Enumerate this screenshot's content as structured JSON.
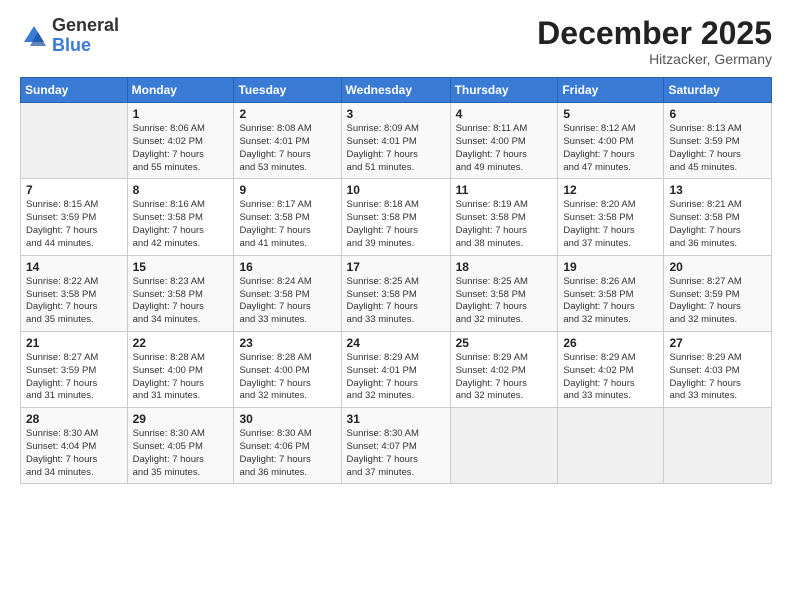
{
  "logo": {
    "general": "General",
    "blue": "Blue"
  },
  "title": "December 2025",
  "subtitle": "Hitzacker, Germany",
  "days_of_week": [
    "Sunday",
    "Monday",
    "Tuesday",
    "Wednesday",
    "Thursday",
    "Friday",
    "Saturday"
  ],
  "weeks": [
    [
      {
        "day": "",
        "info": ""
      },
      {
        "day": "1",
        "info": "Sunrise: 8:06 AM\nSunset: 4:02 PM\nDaylight: 7 hours\nand 55 minutes."
      },
      {
        "day": "2",
        "info": "Sunrise: 8:08 AM\nSunset: 4:01 PM\nDaylight: 7 hours\nand 53 minutes."
      },
      {
        "day": "3",
        "info": "Sunrise: 8:09 AM\nSunset: 4:01 PM\nDaylight: 7 hours\nand 51 minutes."
      },
      {
        "day": "4",
        "info": "Sunrise: 8:11 AM\nSunset: 4:00 PM\nDaylight: 7 hours\nand 49 minutes."
      },
      {
        "day": "5",
        "info": "Sunrise: 8:12 AM\nSunset: 4:00 PM\nDaylight: 7 hours\nand 47 minutes."
      },
      {
        "day": "6",
        "info": "Sunrise: 8:13 AM\nSunset: 3:59 PM\nDaylight: 7 hours\nand 45 minutes."
      }
    ],
    [
      {
        "day": "7",
        "info": "Sunrise: 8:15 AM\nSunset: 3:59 PM\nDaylight: 7 hours\nand 44 minutes."
      },
      {
        "day": "8",
        "info": "Sunrise: 8:16 AM\nSunset: 3:58 PM\nDaylight: 7 hours\nand 42 minutes."
      },
      {
        "day": "9",
        "info": "Sunrise: 8:17 AM\nSunset: 3:58 PM\nDaylight: 7 hours\nand 41 minutes."
      },
      {
        "day": "10",
        "info": "Sunrise: 8:18 AM\nSunset: 3:58 PM\nDaylight: 7 hours\nand 39 minutes."
      },
      {
        "day": "11",
        "info": "Sunrise: 8:19 AM\nSunset: 3:58 PM\nDaylight: 7 hours\nand 38 minutes."
      },
      {
        "day": "12",
        "info": "Sunrise: 8:20 AM\nSunset: 3:58 PM\nDaylight: 7 hours\nand 37 minutes."
      },
      {
        "day": "13",
        "info": "Sunrise: 8:21 AM\nSunset: 3:58 PM\nDaylight: 7 hours\nand 36 minutes."
      }
    ],
    [
      {
        "day": "14",
        "info": "Sunrise: 8:22 AM\nSunset: 3:58 PM\nDaylight: 7 hours\nand 35 minutes."
      },
      {
        "day": "15",
        "info": "Sunrise: 8:23 AM\nSunset: 3:58 PM\nDaylight: 7 hours\nand 34 minutes."
      },
      {
        "day": "16",
        "info": "Sunrise: 8:24 AM\nSunset: 3:58 PM\nDaylight: 7 hours\nand 33 minutes."
      },
      {
        "day": "17",
        "info": "Sunrise: 8:25 AM\nSunset: 3:58 PM\nDaylight: 7 hours\nand 33 minutes."
      },
      {
        "day": "18",
        "info": "Sunrise: 8:25 AM\nSunset: 3:58 PM\nDaylight: 7 hours\nand 32 minutes."
      },
      {
        "day": "19",
        "info": "Sunrise: 8:26 AM\nSunset: 3:58 PM\nDaylight: 7 hours\nand 32 minutes."
      },
      {
        "day": "20",
        "info": "Sunrise: 8:27 AM\nSunset: 3:59 PM\nDaylight: 7 hours\nand 32 minutes."
      }
    ],
    [
      {
        "day": "21",
        "info": "Sunrise: 8:27 AM\nSunset: 3:59 PM\nDaylight: 7 hours\nand 31 minutes."
      },
      {
        "day": "22",
        "info": "Sunrise: 8:28 AM\nSunset: 4:00 PM\nDaylight: 7 hours\nand 31 minutes."
      },
      {
        "day": "23",
        "info": "Sunrise: 8:28 AM\nSunset: 4:00 PM\nDaylight: 7 hours\nand 32 minutes."
      },
      {
        "day": "24",
        "info": "Sunrise: 8:29 AM\nSunset: 4:01 PM\nDaylight: 7 hours\nand 32 minutes."
      },
      {
        "day": "25",
        "info": "Sunrise: 8:29 AM\nSunset: 4:02 PM\nDaylight: 7 hours\nand 32 minutes."
      },
      {
        "day": "26",
        "info": "Sunrise: 8:29 AM\nSunset: 4:02 PM\nDaylight: 7 hours\nand 33 minutes."
      },
      {
        "day": "27",
        "info": "Sunrise: 8:29 AM\nSunset: 4:03 PM\nDaylight: 7 hours\nand 33 minutes."
      }
    ],
    [
      {
        "day": "28",
        "info": "Sunrise: 8:30 AM\nSunset: 4:04 PM\nDaylight: 7 hours\nand 34 minutes."
      },
      {
        "day": "29",
        "info": "Sunrise: 8:30 AM\nSunset: 4:05 PM\nDaylight: 7 hours\nand 35 minutes."
      },
      {
        "day": "30",
        "info": "Sunrise: 8:30 AM\nSunset: 4:06 PM\nDaylight: 7 hours\nand 36 minutes."
      },
      {
        "day": "31",
        "info": "Sunrise: 8:30 AM\nSunset: 4:07 PM\nDaylight: 7 hours\nand 37 minutes."
      },
      {
        "day": "",
        "info": ""
      },
      {
        "day": "",
        "info": ""
      },
      {
        "day": "",
        "info": ""
      }
    ]
  ]
}
